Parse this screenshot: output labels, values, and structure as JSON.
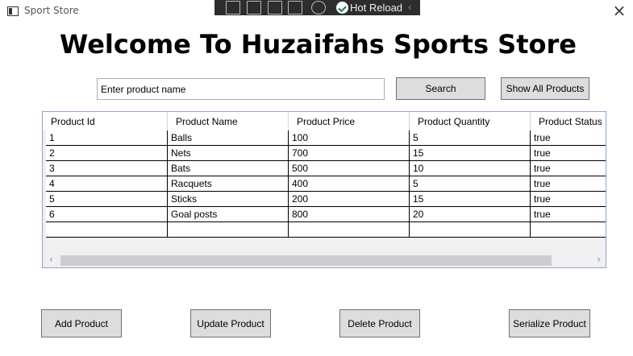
{
  "window": {
    "title": "Sport Store",
    "close_glyph": "×"
  },
  "hot_reload_toolbar": {
    "label": "Hot Reload",
    "collapse_glyph": "‹"
  },
  "heading": "Welcome To Huzaifahs Sports Store",
  "search": {
    "value": "Enter product name",
    "button_label": "Search"
  },
  "show_all_label": "Show All Products",
  "table": {
    "columns": [
      "Product Id",
      "Product Name",
      "Product Price",
      "Product Quantity",
      "Product Status"
    ],
    "rows": [
      [
        "1",
        "Balls",
        "100",
        "5",
        "true"
      ],
      [
        "2",
        "Nets",
        "700",
        "15",
        "true"
      ],
      [
        "3",
        "Bats",
        "500",
        "10",
        "true"
      ],
      [
        "4",
        "Racquets",
        "400",
        "5",
        "true"
      ],
      [
        "5",
        "Sticks",
        "200",
        "15",
        "true"
      ],
      [
        "6",
        "Goal posts",
        "800",
        "20",
        "true"
      ],
      [
        "",
        "",
        "",
        "",
        ""
      ]
    ],
    "scroll_left_glyph": "‹",
    "scroll_right_glyph": "›"
  },
  "actions": {
    "add": "Add Product",
    "update": "Update Product",
    "delete": "Delete Product",
    "serialize": "Serialize Product"
  }
}
